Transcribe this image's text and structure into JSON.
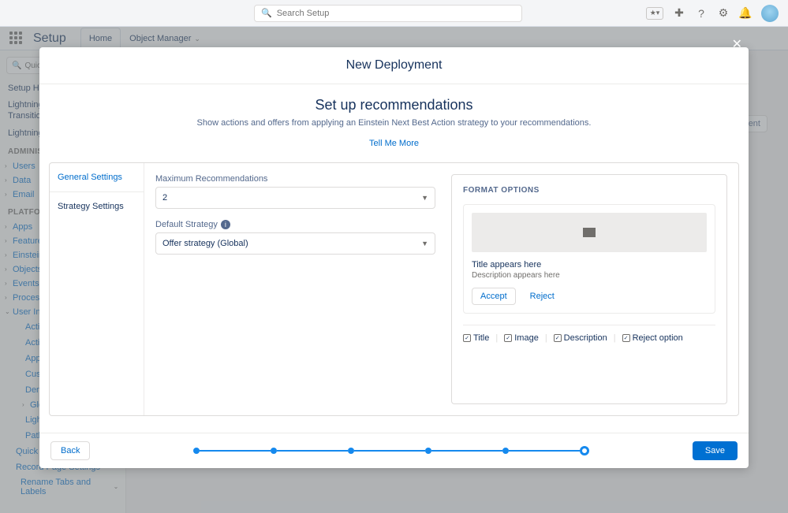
{
  "topbar": {
    "search_placeholder": "Search Setup"
  },
  "nav": {
    "app_title": "Setup",
    "tabs": [
      {
        "label": "Home",
        "active": true
      },
      {
        "label": "Object Manager",
        "active": false
      }
    ]
  },
  "sidebar": {
    "quick_find": "Quick",
    "items_top": [
      "Setup Home",
      "Lightning Experience Transition Assistant",
      "Lightning Usage"
    ],
    "admin_head": "ADMINISTRATION",
    "admin": [
      "Users",
      "Data",
      "Email"
    ],
    "plat_head": "PLATFORM TOOLS",
    "plat": [
      "Apps",
      "Feature Settings",
      "Einstein",
      "Objects and Fields",
      "Events",
      "Process Automation",
      "User Interface"
    ],
    "ui_sub": [
      "Action Link Templates",
      "Actions & Recommendations",
      "App Menu",
      "Custom Labels",
      "Density Settings",
      "Global Actions",
      "Lightning App Builder",
      "Path Settings",
      "Quick Text Settings",
      "Record Page Settings",
      "Rename Tabs and Labels"
    ]
  },
  "bg_button": "…yment",
  "modal": {
    "title": "New Deployment",
    "heading": "Set up recommendations",
    "subheading": "Show actions and offers from applying an Einstein Next Best Action strategy to your recommendations.",
    "link": "Tell Me More",
    "side_tabs": {
      "general": "General Settings",
      "strategy": "Strategy Settings"
    },
    "fields": {
      "max_label": "Maximum Recommendations",
      "max_value": "2",
      "strat_label": "Default Strategy",
      "strat_value": "Offer strategy (Global)"
    },
    "format": {
      "head": "FORMAT OPTIONS",
      "title_text": "Title appears here",
      "desc_text": "Description appears here",
      "accept": "Accept",
      "reject": "Reject",
      "checks": [
        "Title",
        "Image",
        "Description",
        "Reject option"
      ]
    },
    "footer": {
      "back": "Back",
      "save": "Save"
    }
  }
}
